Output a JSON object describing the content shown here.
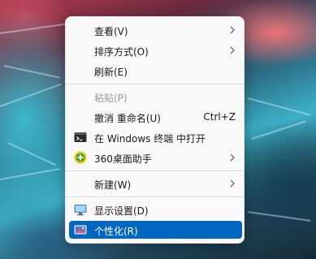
{
  "context_menu": {
    "items": [
      {
        "label": "查看(V)",
        "has_submenu": true,
        "disabled": false
      },
      {
        "label": "排序方式(O)",
        "has_submenu": true,
        "disabled": false
      },
      {
        "label": "刷新(E)",
        "has_submenu": false,
        "disabled": false
      },
      {
        "label": "粘贴(P)",
        "has_submenu": false,
        "disabled": true
      },
      {
        "label": "撤消 重命名(U)",
        "shortcut": "Ctrl+Z",
        "has_submenu": false,
        "disabled": false
      },
      {
        "label": "在 Windows 终端 中打开",
        "icon": "terminal-icon",
        "has_submenu": false,
        "disabled": false
      },
      {
        "label": "360桌面助手",
        "icon": "360-assistant-icon",
        "has_submenu": true,
        "disabled": false
      },
      {
        "label": "新建(W)",
        "has_submenu": true,
        "disabled": false
      },
      {
        "label": "显示设置(D)",
        "icon": "display-settings-icon",
        "has_submenu": false,
        "disabled": false
      },
      {
        "label": "个性化(R)",
        "icon": "personalize-icon",
        "has_submenu": false,
        "disabled": false,
        "highlighted": true
      }
    ]
  },
  "colors": {
    "menu_background": "#f9f9f9",
    "highlight": "#0067c0",
    "disabled_text": "#9a9a9a",
    "separator": "#dcdcdc"
  }
}
